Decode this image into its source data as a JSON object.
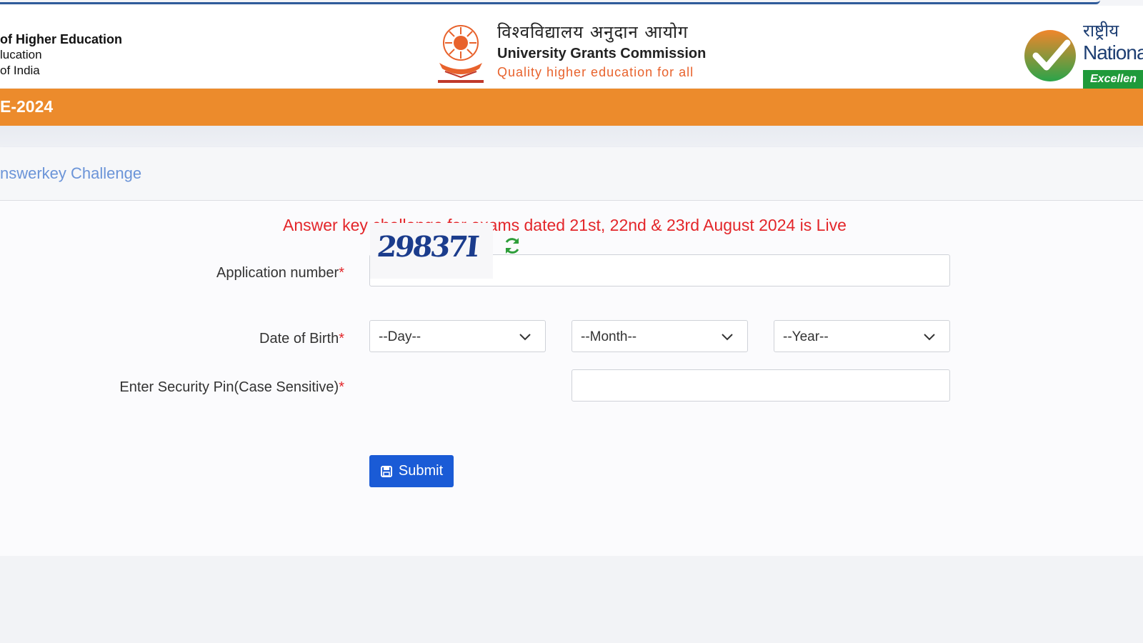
{
  "header": {
    "ministry_line1": "of Higher Education",
    "ministry_line2": "lucation",
    "ministry_line3": "of India",
    "ugc_hindi": "विश्वविद्यालय अनुदान आयोग",
    "ugc_english": "University Grants Commission",
    "ugc_tagline": "Quality higher education for all",
    "nta_hindi": "राष्ट्रीय",
    "nta_english": "Nationa",
    "nta_badge": "Excellen"
  },
  "banner": {
    "title": "E-2024"
  },
  "card": {
    "title": "nswerkey Challenge",
    "notice": "Answer key challange for exams dated 21st, 22nd & 23rd August 2024 is Live"
  },
  "form": {
    "application_label": "Application number",
    "application_value": "",
    "dob_label": "Date of Birth",
    "day_selected": "--Day--",
    "month_selected": "--Month--",
    "year_selected": "--Year--",
    "pin_label": "Enter Security Pin(Case Sensitive)",
    "captcha_text": "29837I",
    "pin_value": "",
    "required_mark": "*",
    "submit_label": "Submit"
  },
  "colors": {
    "orange": "#ec8b2c",
    "link_blue": "#6b94d8",
    "notice_red": "#e3262a",
    "button_blue": "#1a5bd6",
    "refresh_green": "#2e9e3a"
  }
}
